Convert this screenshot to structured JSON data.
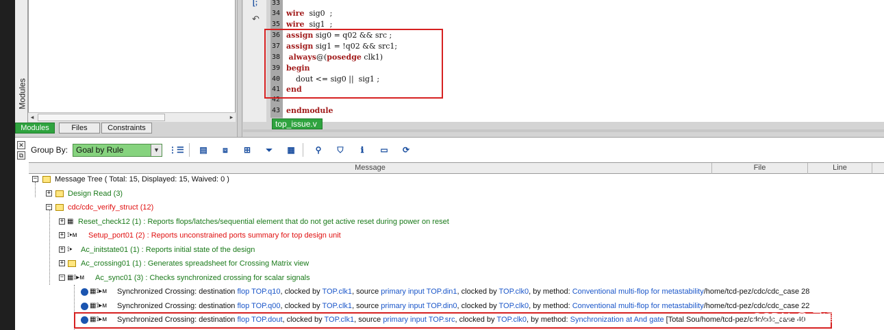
{
  "left_panel": {
    "vertical_label": "Modules",
    "tabs": [
      {
        "label": "Modules"
      },
      {
        "label": "Files"
      },
      {
        "label": "Constraints"
      }
    ]
  },
  "editor": {
    "lines": [
      {
        "n": "33",
        "code": ""
      },
      {
        "n": "34",
        "code": "wire  sig0  ;"
      },
      {
        "n": "35",
        "code": "wire  sig1  ;"
      },
      {
        "n": "36",
        "code": "assign sig0 = q02 && src ;"
      },
      {
        "n": "37",
        "code": "assign sig1 = !q02 && src1;"
      },
      {
        "n": "38",
        "code": " always@(posedge clk1)"
      },
      {
        "n": "39",
        "code": "begin"
      },
      {
        "n": "40",
        "code": "    dout <= sig0 ||  sig1 ;"
      },
      {
        "n": "41",
        "code": "end"
      },
      {
        "n": "42",
        "code": ""
      },
      {
        "n": "43",
        "code": "endmodule"
      }
    ],
    "file_tab": "top_issue.v"
  },
  "toolbar": {
    "group_by_label": "Group By:",
    "group_by_value": "Goal by Rule"
  },
  "table": {
    "columns": [
      "Message",
      "File",
      "Line"
    ],
    "rows": [
      {
        "text": "Message Tree ( Total: 15, Displayed: 15, Waived: 0 )"
      },
      {
        "text": "Design Read (3)"
      },
      {
        "text": "cdc/cdc_verify_struct (12)"
      },
      {
        "text": "Reset_check12 (1) : Reports flops/latches/sequential element that do not get active reset during power on reset"
      },
      {
        "text": "Setup_port01 (2) : Reports unconstrained ports summary for top design unit"
      },
      {
        "text": "Ac_initstate01 (1) : Reports initial state of the design"
      },
      {
        "text": "Ac_crossing01 (1) : Generates spreadsheet for Crossing Matrix view"
      },
      {
        "text": "Ac_sync01 (3) : Checks synchronized crossing for scalar signals"
      }
    ],
    "detail_rows": [
      {
        "prefix": "Synchronized Crossing: destination ",
        "dest": "flop TOP.q10",
        "clk1_pre": ", clocked by ",
        "clk1": "TOP.clk1",
        "src_pre": ", source ",
        "src": "primary input TOP.din1",
        "clk2_pre": ", clocked by ",
        "clk2": "TOP.clk0",
        "method_pre": ", by method: ",
        "method": "Conventional multi-flop for metastability",
        "tail": "/home/tcd-pez/cdc/cdc_case 28"
      },
      {
        "prefix": "Synchronized Crossing: destination ",
        "dest": "flop TOP.q00",
        "clk1_pre": ", clocked by ",
        "clk1": "TOP.clk1",
        "src_pre": ", source ",
        "src": "primary input TOP.din0",
        "clk2_pre": ", clocked by ",
        "clk2": "TOP.clk0",
        "method_pre": ", by method: ",
        "method": "Conventional multi-flop for metastability",
        "tail": "/home/tcd-pez/cdc/cdc_case 22"
      },
      {
        "prefix": "Synchronized Crossing: destination ",
        "dest": "flop TOP.dout",
        "clk1_pre": ", clocked by ",
        "clk1": "TOP.clk1",
        "src_pre": ", source ",
        "src": "primary input TOP.src",
        "clk2_pre": ", clocked by ",
        "clk2": "TOP.clk0",
        "method_pre": ", by method: ",
        "method": "Synchronization at And gate",
        "tail": " [Total Sou/home/tcd-pez/cdc/cdc_case 40"
      }
    ]
  },
  "watermark": "CSDN @ 飞哥一芯",
  "colors": {
    "accent_green": "#2fa33f",
    "highlight_row": "#8ef08a",
    "annotation_red": "#d62020",
    "keyword": "#a11a1a"
  }
}
